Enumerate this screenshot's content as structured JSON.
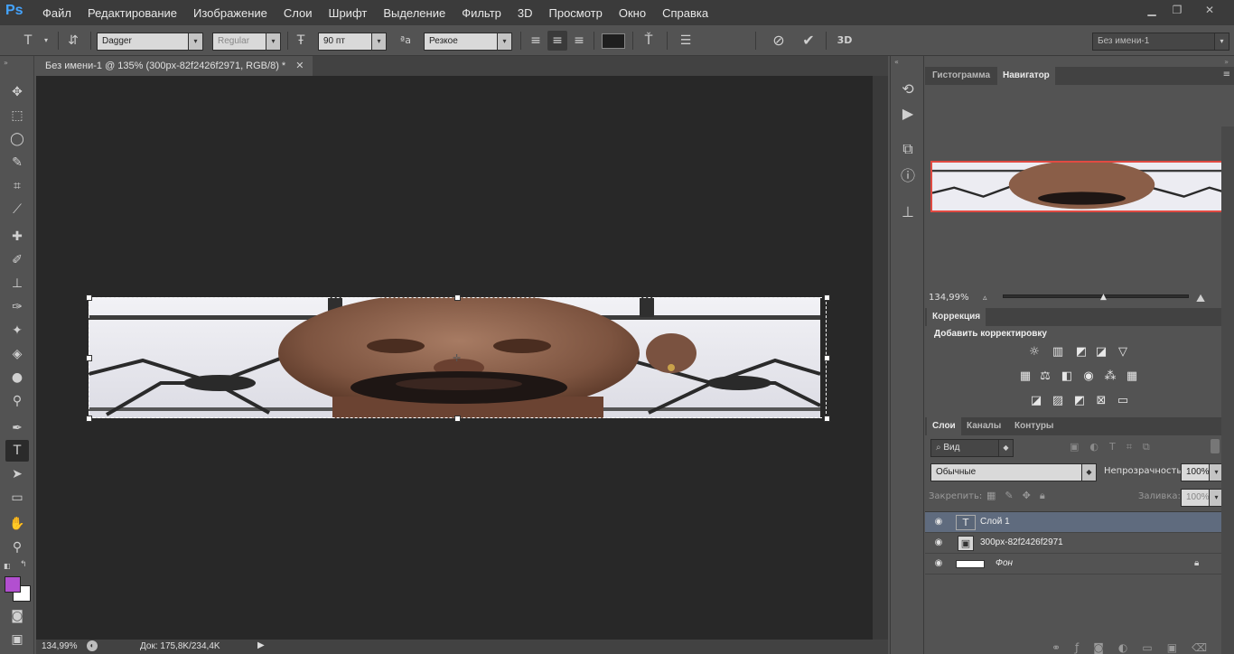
{
  "app": {
    "logo": "Ps"
  },
  "menu": [
    "Файл",
    "Редактирование",
    "Изображение",
    "Слои",
    "Шрифт",
    "Выделение",
    "Фильтр",
    "3D",
    "Просмотр",
    "Окно",
    "Справка"
  ],
  "options": {
    "font_family": "Dagger",
    "font_style": "Regular",
    "font_size": "90 пт",
    "aa_label": "ªa",
    "antialias": "Резкое",
    "label_3d": "3D",
    "workspace": "Без имени-1"
  },
  "document": {
    "tab_title": "Без имени-1 @ 135% (300px-82f2426f2971, RGB/8) *",
    "zoom": "134,99%",
    "doc_info": "Док: 175,8K/234,4K"
  },
  "navigator": {
    "tabs": [
      "Гистограмма",
      "Навигатор"
    ],
    "zoom": "134,99%"
  },
  "correction": {
    "tab": "Коррекция",
    "title": "Добавить корректировку"
  },
  "layers": {
    "tabs": [
      "Слои",
      "Каналы",
      "Контуры"
    ],
    "filter_kind": "Вид",
    "blend_mode": "Обычные",
    "opacity_label": "Непрозрачность:",
    "opacity": "100%",
    "lock_label": "Закрепить:",
    "fill_label": "Заливка:",
    "fill": "100%",
    "items": [
      {
        "name": "Слой 1"
      },
      {
        "name": "300px-82f2426f2971"
      },
      {
        "name": "Фон"
      }
    ]
  },
  "colors": {
    "foreground": "#b24fd0",
    "background": "#ffffff"
  }
}
